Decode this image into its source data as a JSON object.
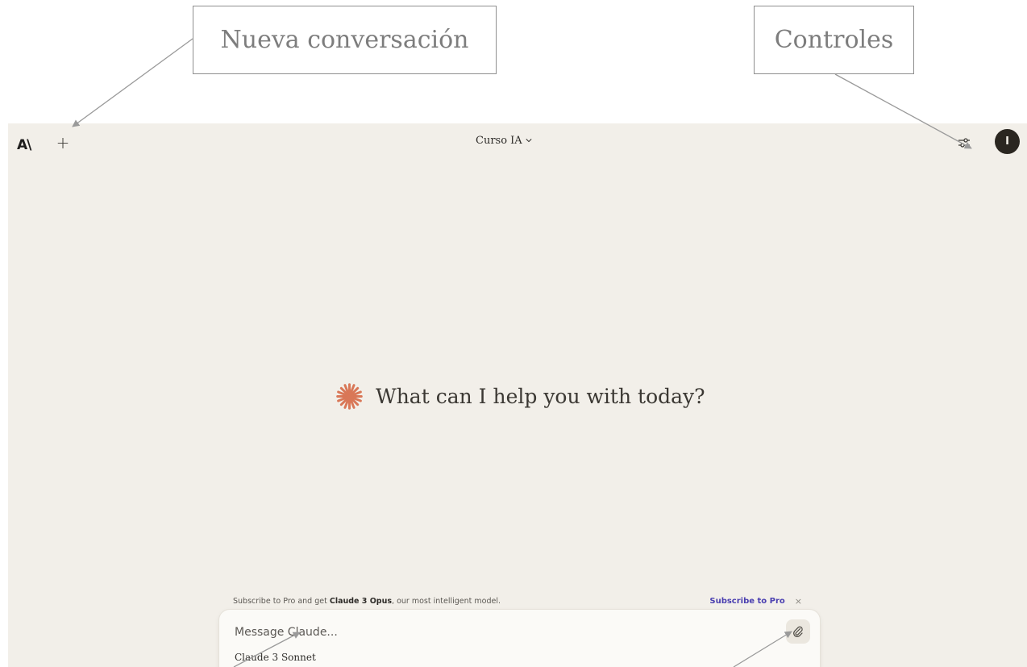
{
  "callouts": {
    "new_conversation": "Nueva conversación",
    "controls": "Controles"
  },
  "header": {
    "logo": "A\\",
    "project_title": "Curso IA",
    "avatar_initial": "I"
  },
  "icons": {
    "new_chat": "plus-icon",
    "title_dropdown": "chevron-down-icon",
    "controls": "sliders-icon",
    "greeting": "sparkle-icon",
    "attach": "paperclip-icon"
  },
  "main": {
    "greeting": "What can I help you with today?"
  },
  "promo": {
    "text_before": "Subscribe to Pro and get ",
    "highlight": "Claude 3 Opus",
    "text_after": ", our most intelligent model.",
    "link": "Subscribe to Pro",
    "close": "×"
  },
  "composer": {
    "placeholder": "Message Claude...",
    "model": "Claude 3 Sonnet"
  },
  "colors": {
    "background": "#f2efe9",
    "accent": "#d97757",
    "link": "#4a3fb0",
    "avatar": "#2a2620"
  }
}
